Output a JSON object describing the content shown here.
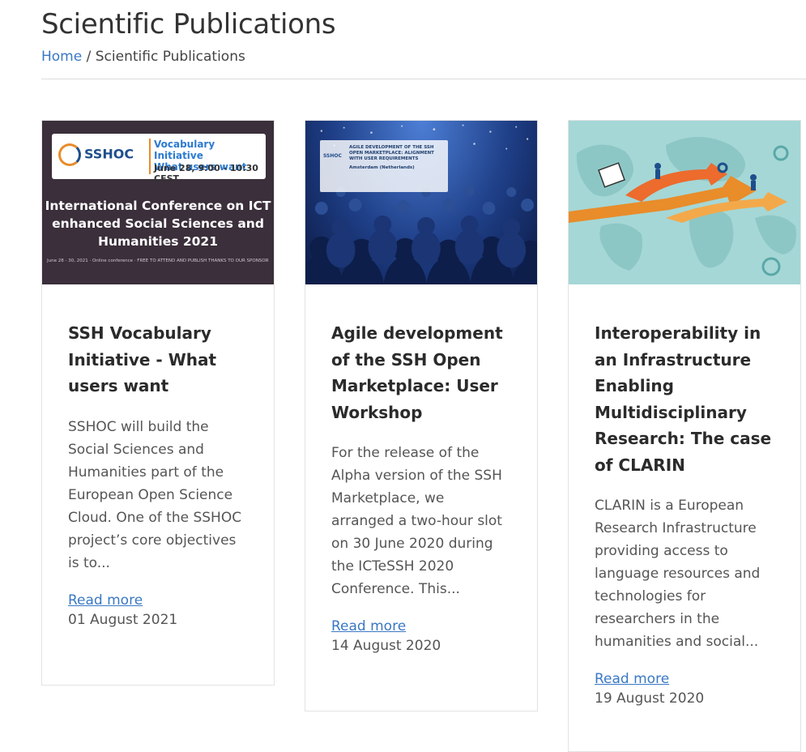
{
  "page": {
    "title": "Scientific Publications",
    "breadcrumb": {
      "home": "Home",
      "separator": "/",
      "current": "Scientific Publications"
    }
  },
  "colors": {
    "link": "#3a78c4",
    "orange": "#e98c2a",
    "brand_blue": "#1f4e8c"
  },
  "cards": [
    {
      "thumbnail": {
        "logo": "SSHOC",
        "banner_title": "Vocabulary Initiative",
        "banner_subtitle": "What users want",
        "banner_date": "June 28, 9:00 - 10:30 CEST",
        "conference_line1": "International Conference on ICT",
        "conference_line2": "enhanced Social Sciences and",
        "conference_line3": "Humanities 2021",
        "fine_print": "June 28 - 30, 2021 · Online conference · FREE TO ATTEND AND PUBLISH THANKS TO OUR SPONSORS"
      },
      "title": "SSH Vocabulary Initiative - What users want",
      "excerpt": "SSHOC will build the Social Sciences and Humanities part of the European Open Science Cloud. One of the SSHOC project’s core objectives is to...",
      "read_more": "Read more",
      "date": "01 August 2021"
    },
    {
      "thumbnail": {
        "logo": "SSHOC",
        "panel_title": "AGILE DEVELOPMENT OF THE SSH OPEN MARKETPLACE: ALIGNMENT WITH USER REQUIREMENTS",
        "panel_location": "Amsterdam (Netherlands)"
      },
      "title": "Agile development of the SSH Open Marketplace: User Workshop",
      "excerpt": "For the release of the Alpha version of the SSH Marketplace, we arranged a two-hour slot on 30 June 2020 during the ICTeSSH 2020 Conference. This...",
      "read_more": "Read more",
      "date": "14 August 2020"
    },
    {
      "thumbnail": {},
      "title": "Interoperability in an Infrastructure Enabling Multidisciplinary Research: The case of CLARIN",
      "excerpt": "CLARIN is a European Research Infrastructure providing access to language resources and technologies for researchers in the humanities and social...",
      "read_more": "Read more",
      "date": "19 August 2020"
    }
  ]
}
